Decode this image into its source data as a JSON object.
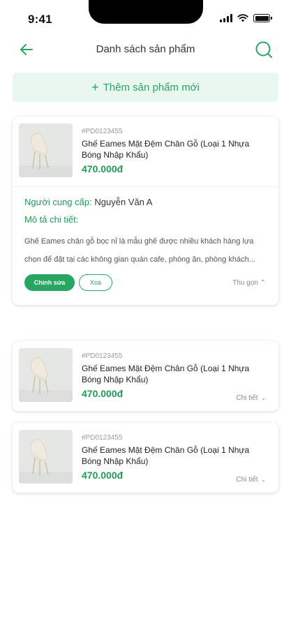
{
  "status_bar": {
    "time": "9:41"
  },
  "header": {
    "title": "Danh sách sản phẩm"
  },
  "add_button": {
    "label": "Thêm sản phẩm mới"
  },
  "products": [
    {
      "sku": "#PD0123455",
      "name": "Ghế Eames Mặt Đệm Chân Gỗ (Loại 1 Nhựa Bóng Nhập Khẩu)",
      "price": "470.000đ",
      "expanded": true,
      "supplier_label": "Người cung cấp:",
      "supplier_name": "Nguyễn Văn A",
      "desc_title": "Mô tả chi tiết:",
      "description": "Ghế Eames chân gỗ bọc nỉ là mẫu ghế được nhiều khách hàng lựa chọn để đặt tại các không gian quán cafe, phòng ăn, phòng khách...",
      "edit_label": "Chỉnh sửa",
      "delete_label": "Xoá",
      "toggle_label": "Thu gọn"
    },
    {
      "sku": "#PD0123455",
      "name": "Ghế Eames Mặt Đệm Chân Gỗ (Loại 1 Nhựa Bóng Nhập Khẩu)",
      "price": "470.000đ",
      "expanded": false,
      "toggle_label": "Chi tiết"
    },
    {
      "sku": "#PD0123455",
      "name": "Ghế Eames Mặt Đệm Chân Gỗ (Loại 1 Nhựa Bóng Nhập Khẩu)",
      "price": "470.000đ",
      "expanded": false,
      "toggle_label": "Chi tiết"
    }
  ],
  "icons": {
    "back": "arrow-left-icon",
    "search": "search-icon",
    "thumbnail": "chair-image"
  },
  "colors": {
    "accent": "#27a563",
    "accent_light": "#eaf7ef",
    "price": "#1f9a57"
  }
}
